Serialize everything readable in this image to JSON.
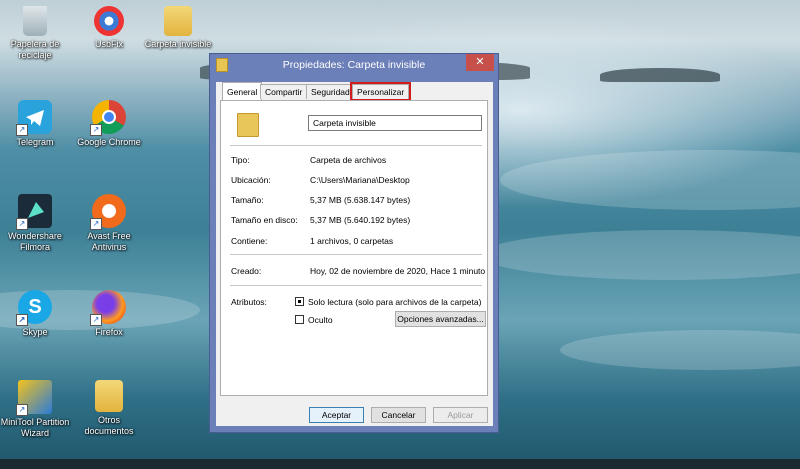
{
  "desktop": {
    "icons": [
      {
        "label": "Papelera de reciclaje",
        "icon": "recycle-bin-icon"
      },
      {
        "label": "UsbFix",
        "icon": "usbfix-icon"
      },
      {
        "label": "Carpeta invisible",
        "icon": "folder-icon"
      },
      {
        "label": "Telegram",
        "icon": "telegram-icon"
      },
      {
        "label": "Google Chrome",
        "icon": "chrome-icon"
      },
      {
        "label": "Wondershare Filmora",
        "icon": "filmora-icon"
      },
      {
        "label": "Avast Free Antivirus",
        "icon": "avast-icon"
      },
      {
        "label": "Skype",
        "icon": "skype-icon"
      },
      {
        "label": "Firefox",
        "icon": "firefox-icon"
      },
      {
        "label": "MiniTool Partition Wizard",
        "icon": "minitool-icon"
      },
      {
        "label": "Otros documentos",
        "icon": "folder-icon"
      }
    ]
  },
  "dialog": {
    "title": "Propiedades: Carpeta invisible",
    "close_label": "✕",
    "tabs": [
      {
        "label": "General"
      },
      {
        "label": "Compartir"
      },
      {
        "label": "Seguridad"
      },
      {
        "label": "Personalizar"
      }
    ],
    "name_value": "Carpeta invisible",
    "properties": [
      {
        "label": "Tipo:",
        "value": "Carpeta de archivos"
      },
      {
        "label": "Ubicación:",
        "value": "C:\\Users\\Mariana\\Desktop"
      },
      {
        "label": "Tamaño:",
        "value": "5,37 MB (5.638.147 bytes)"
      },
      {
        "label": "Tamaño en disco:",
        "value": "5,37 MB (5.640.192 bytes)"
      },
      {
        "label": "Contiene:",
        "value": "1 archivos, 0 carpetas"
      }
    ],
    "created": {
      "label": "Creado:",
      "value": "Hoy, 02 de noviembre de 2020, Hace 1 minuto"
    },
    "attributes": {
      "label": "Atributos:",
      "readonly_label": "Solo lectura (solo para archivos de la carpeta)",
      "readonly_state": "indeterminate",
      "hidden_label": "Oculto",
      "hidden_checked": false,
      "advanced_label": "Opciones avanzadas..."
    },
    "buttons": {
      "accept": "Aceptar",
      "cancel": "Cancelar",
      "apply": "Aplicar"
    }
  },
  "colors": {
    "highlight": "#d11c1c",
    "dialog_frame": "#6b7fb8",
    "close_button": "#c7504b"
  }
}
